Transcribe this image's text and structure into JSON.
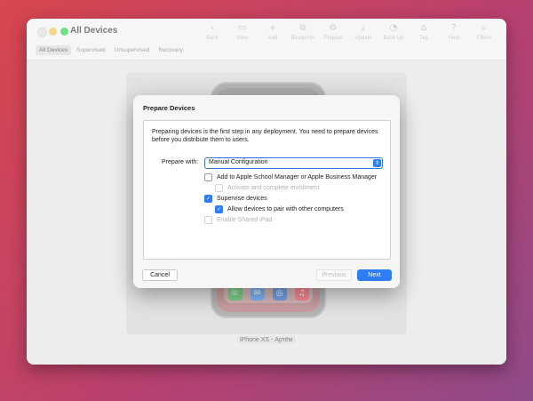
{
  "window": {
    "title": "All Devices"
  },
  "toolbar": [
    {
      "icon": "chevron-left-icon",
      "glyph": "‹",
      "label": "Back"
    },
    {
      "icon": "view-icon",
      "glyph": "▭",
      "label": "View"
    },
    {
      "icon": "add-icon",
      "glyph": "+",
      "label": "Add"
    },
    {
      "icon": "blueprints-icon",
      "glyph": "⧉",
      "label": "Blueprints"
    },
    {
      "icon": "prepare-icon",
      "glyph": "⚙",
      "label": "Prepare"
    },
    {
      "icon": "update-icon",
      "glyph": "⤓",
      "label": "Update"
    },
    {
      "icon": "backup-icon",
      "glyph": "◔",
      "label": "Back Up"
    },
    {
      "icon": "tag-icon",
      "glyph": "⌂",
      "label": "Tag"
    },
    {
      "icon": "help-icon",
      "glyph": "?",
      "label": "Help"
    },
    {
      "icon": "search-icon",
      "glyph": "⌕",
      "label": "Filters"
    }
  ],
  "tabs": [
    "All Devices",
    "Supervised",
    "Unsupervised",
    "Recovery"
  ],
  "device": {
    "label": "iPhone XS - Артём"
  },
  "dialog": {
    "title": "Prepare Devices",
    "description": "Preparing devices is the first step in any deployment. You need to prepare devices before you distribute them to users.",
    "prepare_with_label": "Prepare with:",
    "prepare_with_value": "Manual Configuration",
    "options": {
      "add_to_manager": "Add to Apple School Manager or Apple Business Manager",
      "activate_enrollment": "Activate and complete enrollment",
      "supervise": "Supervise devices",
      "allow_pair": "Allow devices to pair with other computers",
      "shared_ipad": "Enable Shared iPad"
    },
    "buttons": {
      "cancel": "Cancel",
      "previous": "Previous",
      "next": "Next"
    }
  },
  "colors": {
    "accent": "#2f7df2"
  }
}
